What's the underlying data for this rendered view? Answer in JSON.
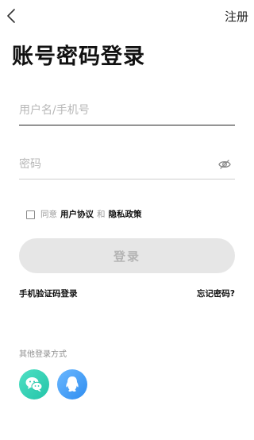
{
  "header": {
    "back_icon": "chevron-left-icon",
    "register_label": "注册"
  },
  "title": "账号密码登录",
  "form": {
    "username_placeholder": "用户名/手机号",
    "username_value": "",
    "password_placeholder": "密码",
    "password_value": "",
    "eye_icon": "eye-off-icon"
  },
  "agreement": {
    "checked": false,
    "prefix": "同意",
    "user_agreement": "用户协议",
    "and": "和",
    "privacy_policy": "隐私政策"
  },
  "login_button": "登录",
  "links": {
    "sms_login": "手机验证码登录",
    "forgot_password": "忘记密码?"
  },
  "other_login": {
    "label": "其他登录方式",
    "options": [
      {
        "icon": "wechat-icon",
        "color": "#2cc9ad"
      },
      {
        "icon": "qq-icon",
        "color": "#3a94f2"
      }
    ]
  },
  "colors": {
    "button_disabled_bg": "#e6e6e6",
    "button_disabled_text": "#b4b4b4",
    "placeholder": "#b7b7b7"
  }
}
